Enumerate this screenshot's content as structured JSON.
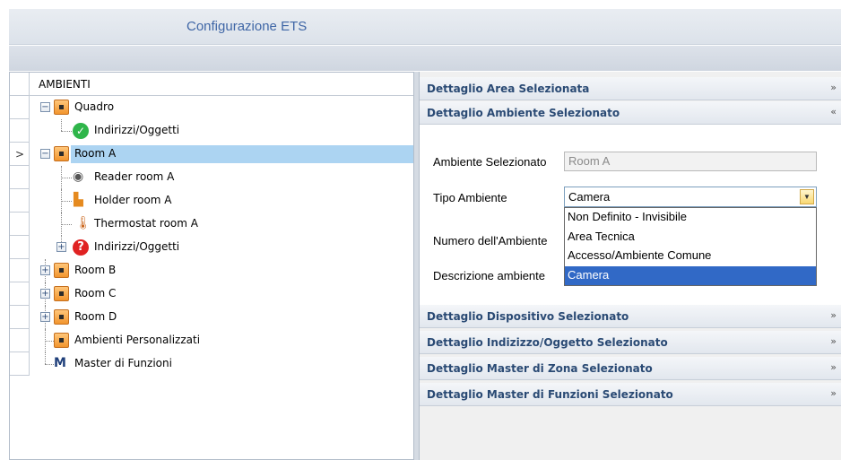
{
  "window": {
    "title": "Configurazione ETS"
  },
  "tree": {
    "column_header": "AMBIENTI",
    "rows": [
      {
        "label": "Quadro"
      },
      {
        "label": "Indirizzi/Oggetti"
      },
      {
        "label": "Room A"
      },
      {
        "label": "Reader room A"
      },
      {
        "label": "Holder room A"
      },
      {
        "label": "Thermostat room A"
      },
      {
        "label": "Indirizzi/Oggetti"
      },
      {
        "label": "Room B"
      },
      {
        "label": "Room C"
      },
      {
        "label": "Room D"
      },
      {
        "label": "Ambienti Personalizzati"
      },
      {
        "label": "Master di Funzioni"
      }
    ]
  },
  "details": {
    "sections": [
      {
        "label": "Dettaglio Area Selezionata",
        "chevron": "»"
      },
      {
        "label": "Dettaglio Ambiente Selezionato",
        "chevron": "«"
      },
      {
        "label": "Dettaglio Dispositivo Selezionato",
        "chevron": "»"
      },
      {
        "label": "Dettaglio Indizizzo/Oggetto Selezionato",
        "chevron": "»"
      },
      {
        "label": "Dettaglio Master di Zona Selezionato",
        "chevron": "»"
      },
      {
        "label": "Dettaglio Master di Funzioni Selezionato",
        "chevron": "»"
      }
    ],
    "form": {
      "ambiente_label": "Ambiente Selezionato",
      "ambiente_value": "Room A",
      "tipo_label": "Tipo Ambiente",
      "tipo_value": "Camera",
      "numero_label": "Numero dell'Ambiente",
      "descrizione_label": "Descrizione ambiente",
      "tipo_options": [
        "Non Definito - Invisibile",
        "Area Tecnica",
        "Accesso/Ambiente Comune",
        "Camera"
      ]
    }
  },
  "icons": {
    "room": "room-icon",
    "check": "check-icon",
    "warning": "warning-icon",
    "reader": "reader-icon",
    "holder": "holder-icon",
    "thermostat": "thermostat-icon",
    "master": "master-icon"
  },
  "colors": {
    "selection": "#acd4f2",
    "accent": "#2a4a74",
    "dropdown_selected": "#3169c6"
  }
}
